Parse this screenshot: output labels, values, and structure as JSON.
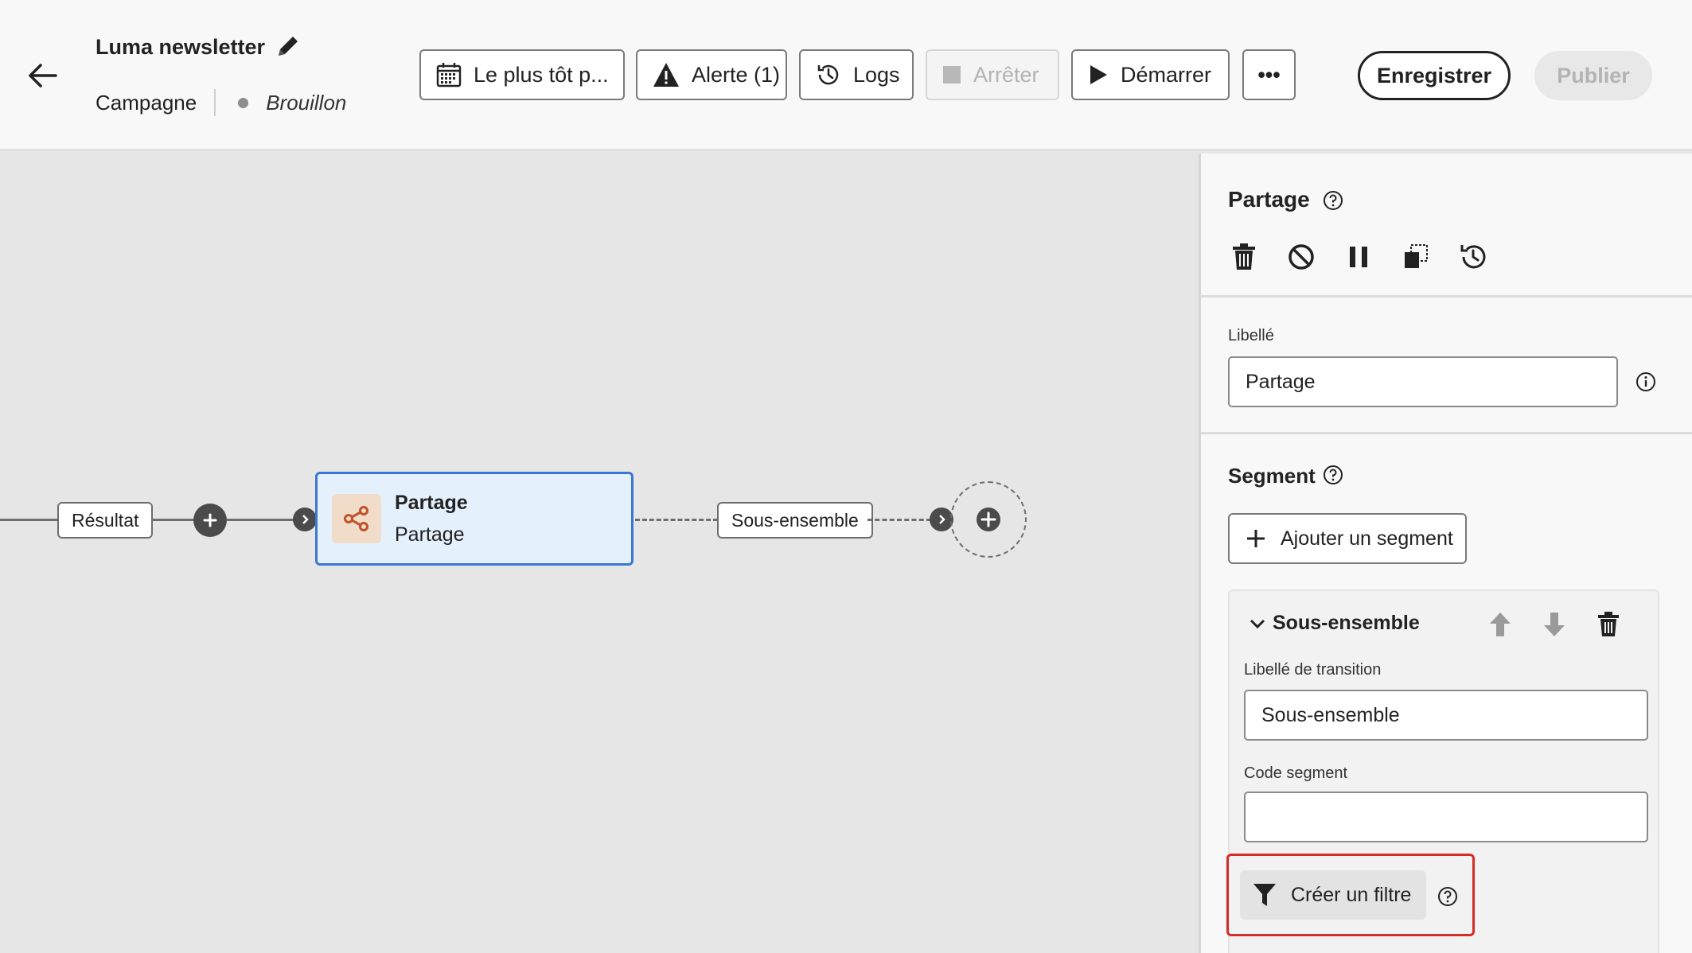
{
  "header": {
    "title": "Luma newsletter",
    "type": "Campagne",
    "status": "Brouillon"
  },
  "toolbar": {
    "schedule_label": "Le plus tôt p...",
    "alert_label": "Alerte (1)",
    "logs_label": "Logs",
    "stop_label": "Arrêter",
    "start_label": "Démarrer",
    "more_label": "•••",
    "save_label": "Enregistrer",
    "publish_label": "Publier"
  },
  "canvas": {
    "incoming_transition": "Résultat",
    "node": {
      "title": "Partage",
      "subtitle": "Partage",
      "icon": "share-icon"
    },
    "outgoing_transition": "Sous-ensemble"
  },
  "panel": {
    "title": "Partage",
    "label_field": {
      "label": "Libellé",
      "value": "Partage"
    },
    "segment": {
      "section_title": "Segment",
      "add_button": "Ajouter un segment",
      "item": {
        "title": "Sous-ensemble",
        "transition_label": "Libellé de transition",
        "transition_value": "Sous-ensemble",
        "code_label": "Code segment",
        "code_value": "",
        "filter_button": "Créer un filtre"
      }
    }
  },
  "colors": {
    "node_border": "#3b77d4",
    "node_fill": "#e5f0fd",
    "node_icon_bg": "#f0dcc8",
    "node_icon": "#c0532b",
    "highlight": "#d52b2b"
  }
}
